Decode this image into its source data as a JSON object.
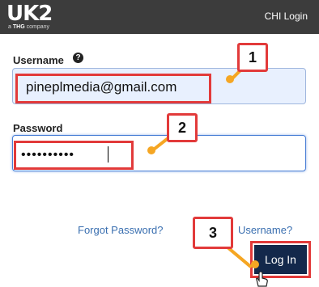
{
  "header": {
    "logo_text": "UK2",
    "logo_tagline_prefix": "a",
    "logo_tagline_brand": "THG",
    "logo_tagline_suffix": "company",
    "chi_login": "CHI Login"
  },
  "form": {
    "username_label": "Username",
    "help_glyph": "?",
    "username_value": "pineplmedia@gmail.com",
    "password_label": "Password",
    "password_value": "••••••••••",
    "forgot_password": "Forgot Password?",
    "forgot_username": "Username?",
    "login_button": "Log In"
  },
  "annotations": {
    "badge_1": "1",
    "badge_2": "2",
    "badge_3": "3"
  },
  "colors": {
    "header_bg": "#3c3c3c",
    "highlight_red": "#e23a3a",
    "pointer_orange": "#f5a623",
    "button_navy": "#13284b",
    "link_blue": "#3a6fb0"
  }
}
